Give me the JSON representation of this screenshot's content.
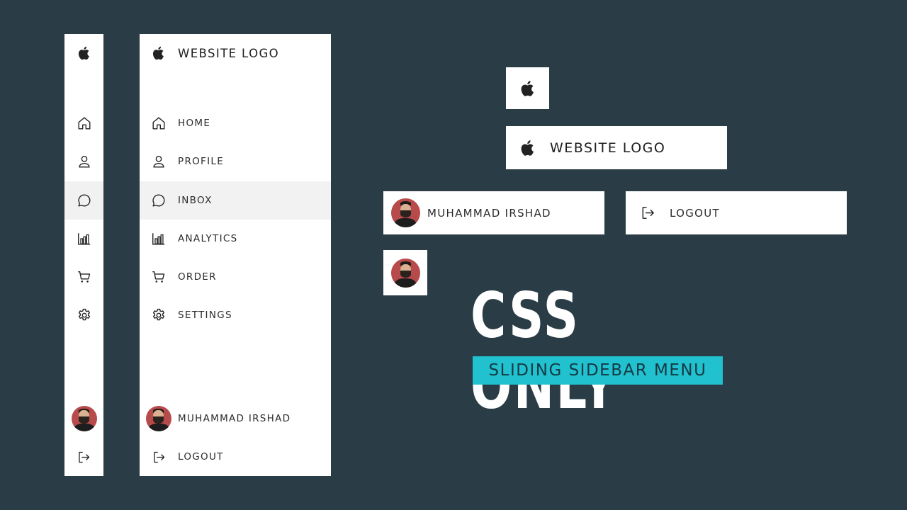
{
  "sidebar": {
    "logo_text": "WEBSITE LOGO",
    "items": [
      {
        "label": "HOME",
        "icon": "home-icon"
      },
      {
        "label": "PROFILE",
        "icon": "user-icon"
      },
      {
        "label": "INBOX",
        "icon": "chat-icon",
        "active": true
      },
      {
        "label": "ANALYTICS",
        "icon": "bar-chart-icon"
      },
      {
        "label": "ORDER",
        "icon": "cart-icon"
      },
      {
        "label": "SETTINGS",
        "icon": "gear-icon"
      }
    ],
    "user_name": "MUHAMMAD IRSHAD",
    "logout_label": "LOGOUT"
  },
  "cards": {
    "logo_text": "WEBSITE LOGO",
    "user_name": "MUHAMMAD IRSHAD",
    "logout_label": "LOGOUT"
  },
  "headline": "CSS ONLY",
  "tagline": "SLIDING SIDEBAR MENU",
  "colors": {
    "background": "#2a3c45",
    "panel": "#ffffff",
    "active_row": "#f2f2f2",
    "accent": "#21c1cf",
    "avatar": "#b74a4a"
  }
}
